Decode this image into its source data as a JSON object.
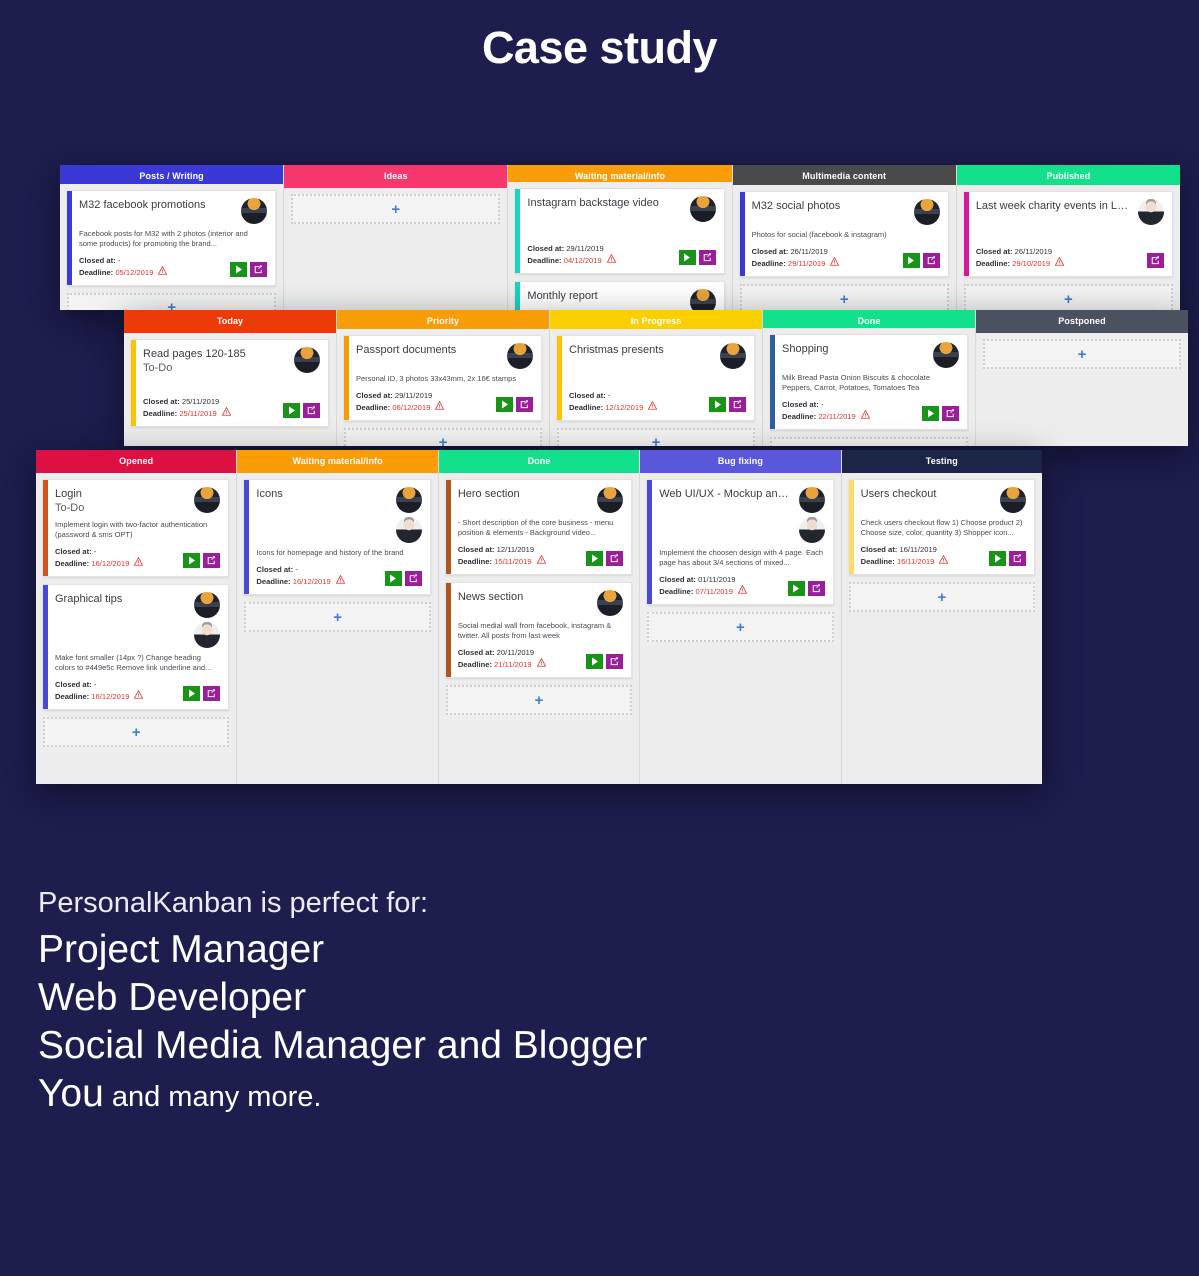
{
  "title": "Case study",
  "boards": [
    {
      "name": "content-board",
      "columns": [
        {
          "header": "Posts / Writing",
          "color": "#3b39d6",
          "cards": [
            {
              "accent": "#3b39d6",
              "title": "M32 facebook promotions",
              "sub": "",
              "desc": "Facebook posts for M32 with 2 photos (interior and some products) for promoting the brand...",
              "closed_label": "Closed at:",
              "closed_value": "-",
              "deadline_label": "Deadline:",
              "deadline_value": "05/12/2019",
              "avatars": [
                "photo-man-dark"
              ],
              "buttons": [
                "play",
                "edit"
              ]
            }
          ],
          "add_slot": true
        },
        {
          "header": "Ideas",
          "color": "#f6386e",
          "cards": [],
          "add_slot": true
        },
        {
          "header": "Waiting material/info",
          "color": "#f89c08",
          "cards": [
            {
              "accent": "#19d3c5",
              "title": "Instagram backstage video",
              "sub": "",
              "desc": "",
              "closed_label": "Closed at:",
              "closed_value": "29/11/2019",
              "deadline_label": "Deadline:",
              "deadline_value": "04/12/2019",
              "avatars": [
                "photo-man-dark"
              ],
              "buttons": [
                "play",
                "edit"
              ]
            },
            {
              "accent": "#19d3c5",
              "title": "Monthly report",
              "sub": "",
              "desc": "",
              "closed_label": "",
              "closed_value": "",
              "deadline_label": "",
              "deadline_value": "",
              "avatars": [
                "photo-man-dark"
              ],
              "buttons": []
            }
          ],
          "add_slot": false
        },
        {
          "header": "Multimedia content",
          "color": "#4a4a4a",
          "cards": [
            {
              "accent": "#3b39d6",
              "title": "M32 social photos",
              "sub": "",
              "desc": "Photos for social (facebook & instagram)",
              "closed_label": "Closed at:",
              "closed_value": "26/11/2019",
              "deadline_label": "Deadline:",
              "deadline_value": "29/11/2019",
              "avatars": [
                "photo-man-dark"
              ],
              "buttons": [
                "play",
                "edit"
              ]
            }
          ],
          "add_slot": true
        },
        {
          "header": "Published",
          "color": "#12e08b",
          "cards": [
            {
              "accent": "#d6179b",
              "title": "Last week charity events in Londo...",
              "sub": "",
              "desc": "",
              "closed_label": "Closed at:",
              "closed_value": "26/11/2019",
              "deadline_label": "Deadline:",
              "deadline_value": "29/10/2019",
              "avatars": [
                "photo-man-light"
              ],
              "buttons": [
                "edit"
              ]
            }
          ],
          "add_slot": true
        }
      ]
    },
    {
      "name": "personal-board",
      "columns": [
        {
          "header": "Today",
          "color": "#eb3c07",
          "cards": [
            {
              "accent": "#fbc300",
              "title": "Read pages 120-185",
              "sub": "To-Do",
              "desc": "",
              "closed_label": "Closed at:",
              "closed_value": "25/11/2019",
              "deadline_label": "Deadline:",
              "deadline_value": "25/11/2019",
              "avatars": [
                "photo-man-dark"
              ],
              "buttons": [
                "play",
                "edit"
              ]
            }
          ],
          "add_slot": false
        },
        {
          "header": "Priority",
          "color": "#f89c08",
          "cards": [
            {
              "accent": "#f89c08",
              "title": "Passport documents",
              "sub": "",
              "desc": "Personal ID, 3 photos 33x43mm, 2x 16€ stamps",
              "closed_label": "Closed at:",
              "closed_value": "29/11/2019",
              "deadline_label": "Deadline:",
              "deadline_value": "06/12/2019",
              "avatars": [
                "photo-man-dark"
              ],
              "buttons": [
                "play",
                "edit"
              ]
            }
          ],
          "add_slot": true
        },
        {
          "header": "In Progress",
          "color": "#fbd000",
          "cards": [
            {
              "accent": "#fbc300",
              "title": "Christmas presents",
              "sub": "",
              "desc": "",
              "closed_label": "Closed at:",
              "closed_value": "-",
              "deadline_label": "Deadline:",
              "deadline_value": "12/12/2019",
              "avatars": [
                "photo-man-dark"
              ],
              "buttons": [
                "play",
                "edit"
              ]
            }
          ],
          "add_slot": true
        },
        {
          "header": "Done",
          "color": "#12e08b",
          "cards": [
            {
              "accent": "#2f5fa0",
              "title": "Shopping",
              "sub": "",
              "desc": "Milk Bread Pasta Onion Biscuits & chocolate Peppers, Carrot, Potatoes, Tomatoes Tea",
              "closed_label": "Closed at:",
              "closed_value": "-",
              "deadline_label": "Deadline:",
              "deadline_value": "22/11/2019",
              "avatars": [
                "photo-man-dark"
              ],
              "buttons": [
                "play",
                "edit"
              ]
            }
          ],
          "add_slot": true
        },
        {
          "header": "Postponed",
          "color": "#4a5161",
          "cards": [],
          "add_slot": true
        }
      ]
    },
    {
      "name": "webdev-board",
      "columns": [
        {
          "header": "Opened",
          "color": "#dc1043",
          "cards": [
            {
              "accent": "#d2521a",
              "title": "Login",
              "sub": "To-Do",
              "desc": "Implement login with two-factor authentication (password & sms OPT)",
              "closed_label": "Closed at:",
              "closed_value": "-",
              "deadline_label": "Deadline:",
              "deadline_value": "16/12/2019",
              "avatars": [
                "photo-man-dark"
              ],
              "buttons": [
                "play",
                "edit"
              ]
            },
            {
              "accent": "#4a48d6",
              "title": "Graphical tips",
              "sub": "",
              "desc": "Make font smaller (14px ?) Change heading colors to #449e5c Remove link underline and...",
              "closed_label": "Closed at:",
              "closed_value": "-",
              "deadline_label": "Deadline:",
              "deadline_value": "16/12/2019",
              "avatars": [
                "photo-man-dark",
                "photo-man-light"
              ],
              "buttons": [
                "play",
                "edit"
              ]
            }
          ],
          "add_slot": true
        },
        {
          "header": "Waiting material/info",
          "color": "#f89c08",
          "cards": [
            {
              "accent": "#4a48d6",
              "title": "Icons",
              "sub": "",
              "desc": "Icons for homepage and history of the brand",
              "closed_label": "Closed at:",
              "closed_value": "-",
              "deadline_label": "Deadline:",
              "deadline_value": "16/12/2019",
              "avatars": [
                "photo-man-dark",
                "photo-man-light"
              ],
              "buttons": [
                "play",
                "edit"
              ]
            }
          ],
          "add_slot": true
        },
        {
          "header": "Done",
          "color": "#12e08b",
          "cards": [
            {
              "accent": "#b1541f",
              "title": "Hero section",
              "sub": "",
              "desc": "- Short description of the core business - menu position & elements - Background video...",
              "closed_label": "Closed at:",
              "closed_value": "12/11/2019",
              "deadline_label": "Deadline:",
              "deadline_value": "15/11/2019",
              "avatars": [
                "photo-man-dark"
              ],
              "buttons": [
                "play",
                "edit"
              ]
            },
            {
              "accent": "#b1541f",
              "title": "News section",
              "sub": "",
              "desc": "Social medial wall from facebook, instagram & twitter. All posts from last week",
              "closed_label": "Closed at:",
              "closed_value": "20/11/2019",
              "deadline_label": "Deadline:",
              "deadline_value": "21/11/2019",
              "avatars": [
                "photo-man-dark"
              ],
              "buttons": [
                "play",
                "edit"
              ]
            }
          ],
          "add_slot": true
        },
        {
          "header": "Bug fixing",
          "color": "#5a57db",
          "cards": [
            {
              "accent": "#4a48d6",
              "title": "Web UI/UX - Mockup and website f...",
              "sub": "",
              "desc": "Implement the choosen design with 4 page. Each page has about 3/4 sections of mixed...",
              "closed_label": "Closed at:",
              "closed_value": "01/11/2019",
              "deadline_label": "Deadline:",
              "deadline_value": "07/11/2019",
              "avatars": [
                "photo-man-dark",
                "photo-man-light"
              ],
              "buttons": [
                "play",
                "edit"
              ]
            }
          ],
          "add_slot": true
        },
        {
          "header": "Testing",
          "color": "#1c2448",
          "cards": [
            {
              "accent": "#fbd96a",
              "title": "Users checkout",
              "sub": "",
              "desc": "Check users checkout flow 1) Choose product 2) Choose size, color, quantity 3) Shopper icon...",
              "closed_label": "Closed at:",
              "closed_value": "16/11/2019",
              "deadline_label": "Deadline:",
              "deadline_value": "16/11/2019",
              "avatars": [
                "photo-man-dark"
              ],
              "buttons": [
                "play",
                "edit"
              ]
            }
          ],
          "add_slot": true
        }
      ]
    }
  ],
  "add_slot_glyph": "+",
  "footer": {
    "intro": "PersonalKanban is perfect for:",
    "lines": [
      "Project Manager",
      "Web Developer",
      "Social Media Manager and Blogger"
    ],
    "last_strong": "You",
    "last_rest": " and many more."
  },
  "colors": {
    "background": "#1d1d4e",
    "board_bg": "#ededed",
    "card_bg": "#ffffff",
    "deadline_red": "#e0352b",
    "play_green": "#1a9418",
    "edit_purple": "#9a1d9a",
    "add_blue": "#3d7fd0"
  }
}
